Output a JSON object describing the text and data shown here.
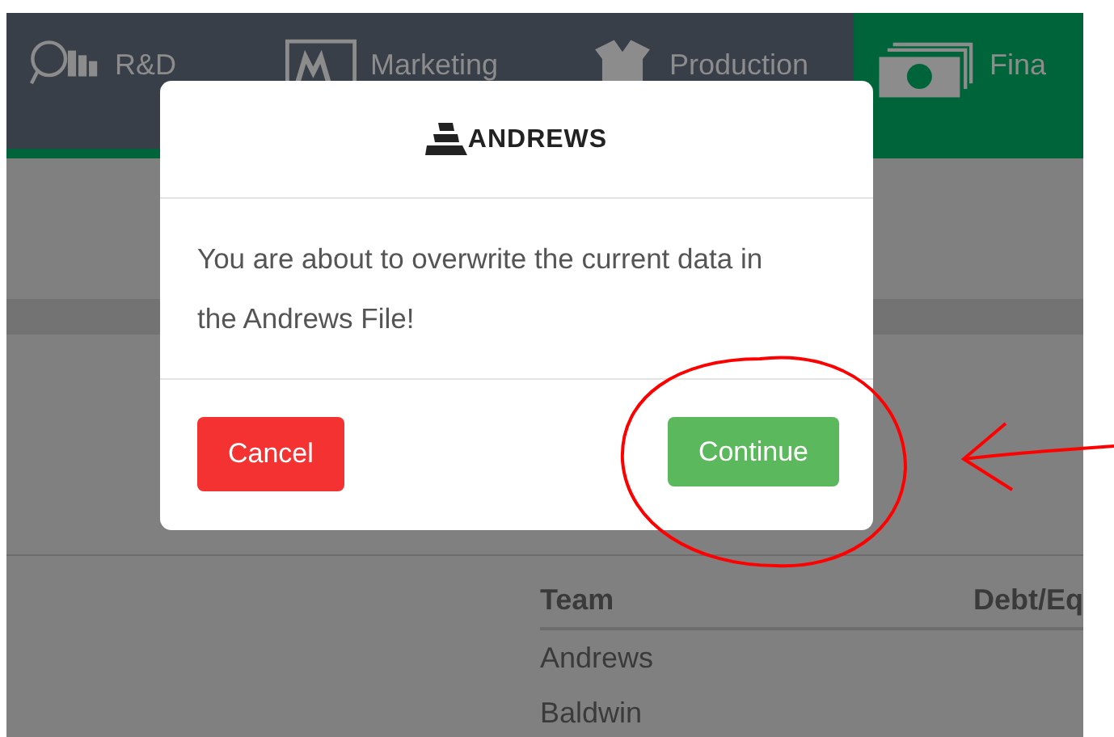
{
  "tabs": [
    {
      "label": "R&D",
      "kind": "rd",
      "selected": false
    },
    {
      "label": "Marketing",
      "kind": "marketing",
      "selected": false
    },
    {
      "label": "Production",
      "kind": "production",
      "selected": false
    },
    {
      "label": "Fina",
      "kind": "finance",
      "selected": true
    }
  ],
  "dialog": {
    "logo": "ANDREWS",
    "message": "You are about to overwrite the current data in the Andrews File!",
    "buttons": [
      {
        "label": "Cancel",
        "kind": "danger"
      },
      {
        "label": "Continue",
        "kind": "success"
      }
    ]
  },
  "table": {
    "columns": [
      "Team",
      "Debt/Eq"
    ],
    "rows": [
      [
        "Andrews"
      ],
      [
        "Baldwin"
      ]
    ]
  }
}
